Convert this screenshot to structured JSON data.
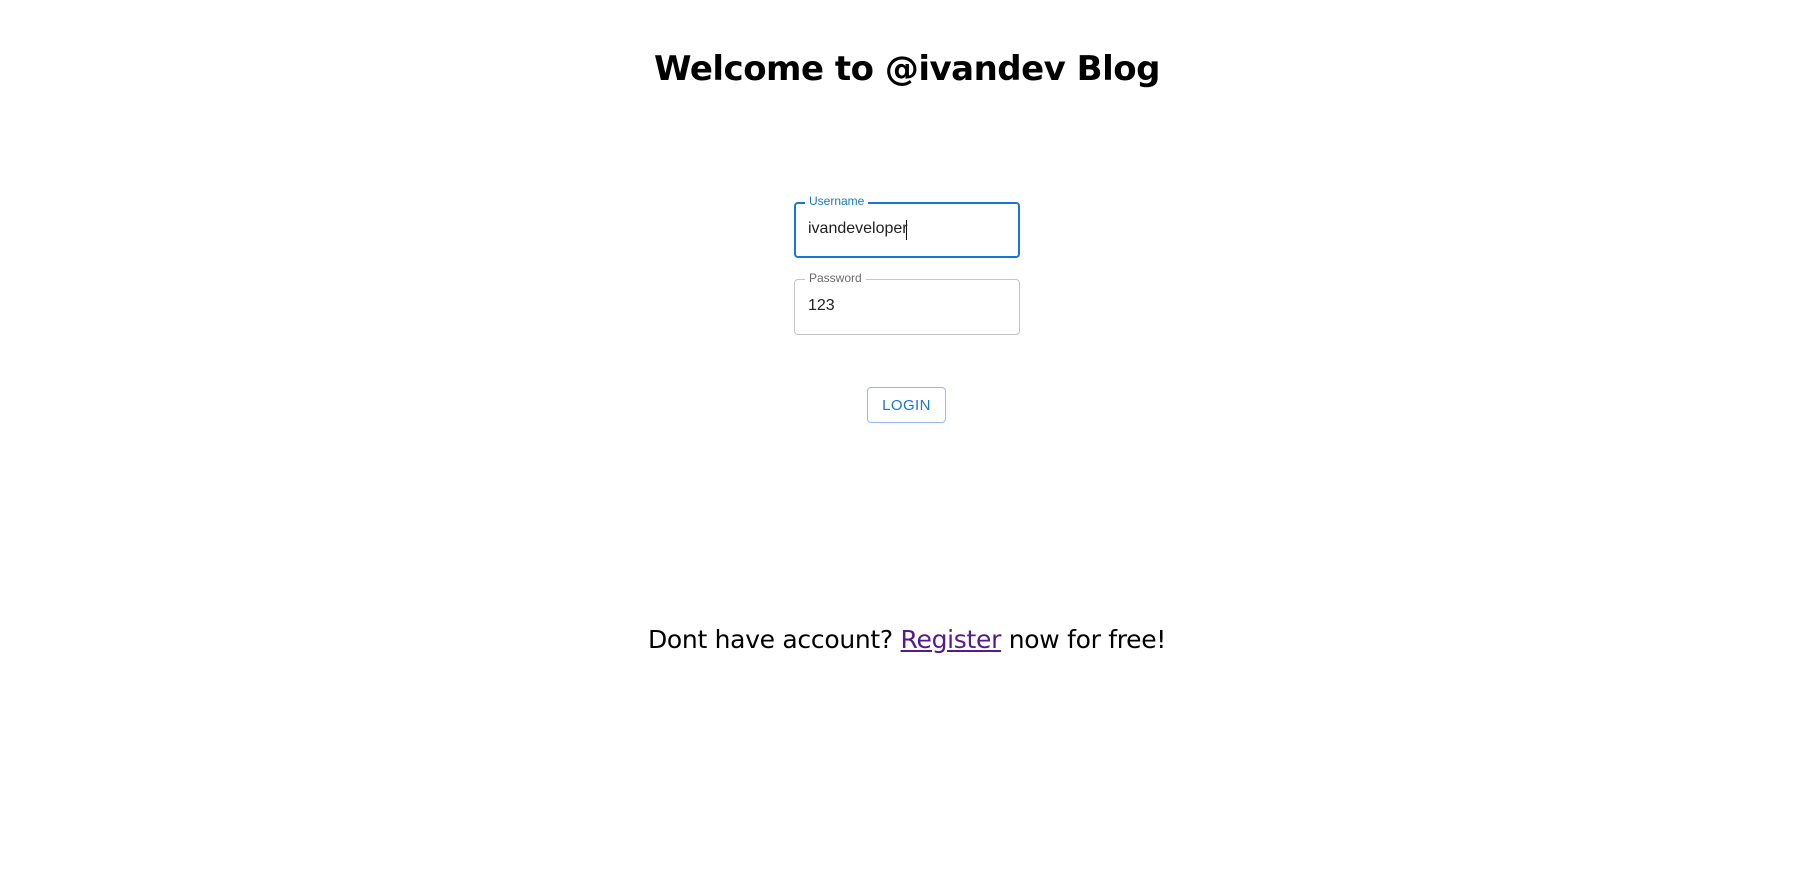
{
  "page": {
    "title": "Welcome to @ivandev Blog"
  },
  "form": {
    "username": {
      "label": "Username",
      "value": "ivandeveloper"
    },
    "password": {
      "label": "Password",
      "value": "123"
    },
    "login_label": "LOGIN"
  },
  "footer": {
    "prefix": "Dont have account?",
    "link_text": "Register",
    "suffix": "now for free!"
  },
  "colors": {
    "accent": "#1976d2",
    "link_visited": "#551a8b",
    "field_border": "#c4c4c4"
  }
}
